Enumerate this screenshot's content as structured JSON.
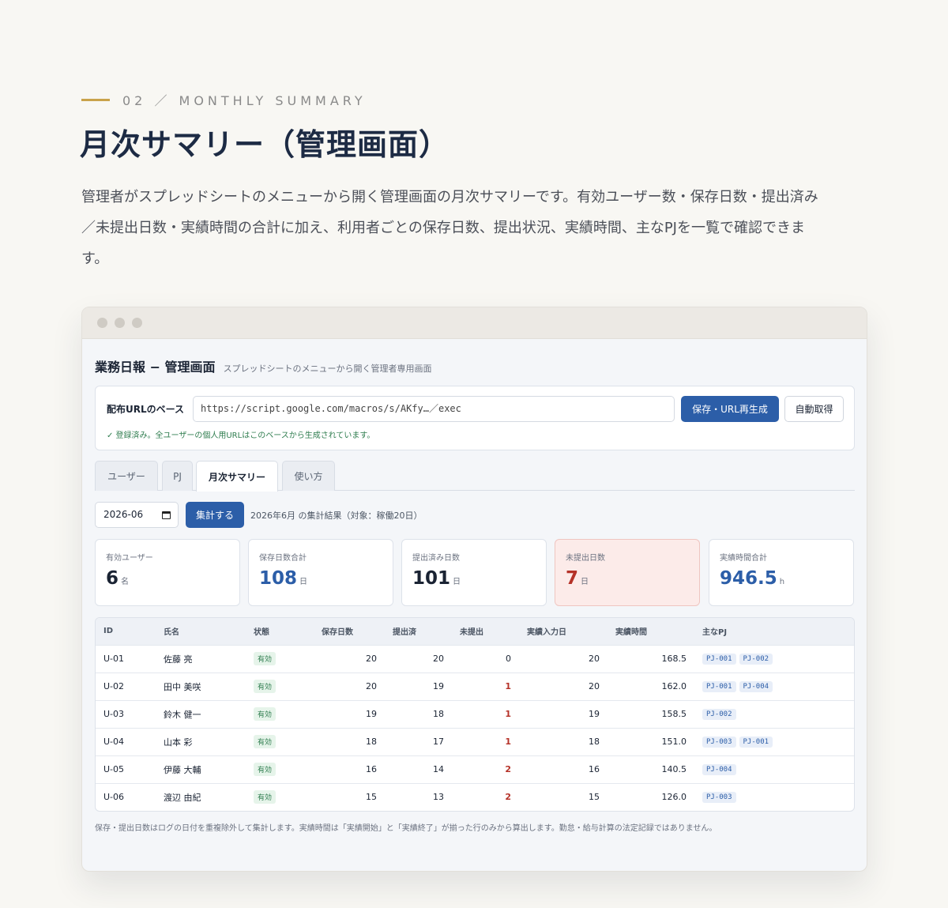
{
  "section": {
    "eyebrow": "02 ／ MONTHLY SUMMARY",
    "title": "月次サマリー（管理画面）",
    "description": "管理者がスプレッドシートのメニューから開く管理画面の月次サマリーです。有効ユーザー数・保存日数・提出済み／未提出日数・実績時間の合計に加え、利用者ごとの保存日数、提出状況、実績時間、主なPJを一覧で確認できます。"
  },
  "app": {
    "title": "業務日報 − 管理画面",
    "subtitle": "スプレッドシートのメニューから開く管理者専用画面"
  },
  "url_config": {
    "label": "配布URLのベース",
    "value": "https://script.google.com/macros/s/AKfy…／exec",
    "save_button": "保存・URL再生成",
    "auto_button": "自動取得",
    "status": "✓ 登録済み。全ユーザーの個人用URLはこのベースから生成されています。"
  },
  "tabs": [
    {
      "label": "ユーザー",
      "active": false
    },
    {
      "label": "PJ",
      "active": false
    },
    {
      "label": "月次サマリー",
      "active": true
    },
    {
      "label": "使い方",
      "active": false
    }
  ],
  "filter": {
    "month": "2026-06",
    "aggregate_button": "集計する",
    "result_text": "2026年6月 の集計結果（対象：稼働20日）"
  },
  "stats": [
    {
      "label": "有効ユーザー",
      "value": "6",
      "unit": "名",
      "style": "default"
    },
    {
      "label": "保存日数合計",
      "value": "108",
      "unit": "日",
      "style": "blue"
    },
    {
      "label": "提出済み日数",
      "value": "101",
      "unit": "日",
      "style": "default"
    },
    {
      "label": "未提出日数",
      "value": "7",
      "unit": "日",
      "style": "red"
    },
    {
      "label": "実績時間合計",
      "value": "946.5",
      "unit": "h",
      "style": "blue"
    }
  ],
  "table": {
    "headers": [
      "ID",
      "氏名",
      "状態",
      "保存日数",
      "提出済",
      "未提出",
      "実績入力日",
      "実績時間",
      "主なPJ"
    ],
    "rows": [
      {
        "id": "U-01",
        "name": "佐藤 亮",
        "status": "有効",
        "saved": "20",
        "submitted": "20",
        "unsubmitted": "0",
        "entry_days": "20",
        "hours": "168.5",
        "pjs": [
          "PJ-001",
          "PJ-002"
        ]
      },
      {
        "id": "U-02",
        "name": "田中 美咲",
        "status": "有効",
        "saved": "20",
        "submitted": "19",
        "unsubmitted": "1",
        "entry_days": "20",
        "hours": "162.0",
        "pjs": [
          "PJ-001",
          "PJ-004"
        ]
      },
      {
        "id": "U-03",
        "name": "鈴木 健一",
        "status": "有効",
        "saved": "19",
        "submitted": "18",
        "unsubmitted": "1",
        "entry_days": "19",
        "hours": "158.5",
        "pjs": [
          "PJ-002"
        ]
      },
      {
        "id": "U-04",
        "name": "山本 彩",
        "status": "有効",
        "saved": "18",
        "submitted": "17",
        "unsubmitted": "1",
        "entry_days": "18",
        "hours": "151.0",
        "pjs": [
          "PJ-003",
          "PJ-001"
        ]
      },
      {
        "id": "U-05",
        "name": "伊藤 大輔",
        "status": "有効",
        "saved": "16",
        "submitted": "14",
        "unsubmitted": "2",
        "entry_days": "16",
        "hours": "140.5",
        "pjs": [
          "PJ-004"
        ]
      },
      {
        "id": "U-06",
        "name": "渡辺 由紀",
        "status": "有効",
        "saved": "15",
        "submitted": "13",
        "unsubmitted": "2",
        "entry_days": "15",
        "hours": "126.0",
        "pjs": [
          "PJ-003"
        ]
      }
    ]
  },
  "footnote": "保存・提出日数はログの日付を重複除外して集計します。実績時間は「実績開始」と「実績終了」が揃った行のみから算出します。勤怠・給与計算の法定記録ではありません。",
  "colors": {
    "accent": "#c9a24a",
    "primary": "#2c5ea8",
    "danger": "#b53228",
    "success": "#2f7d4f"
  }
}
